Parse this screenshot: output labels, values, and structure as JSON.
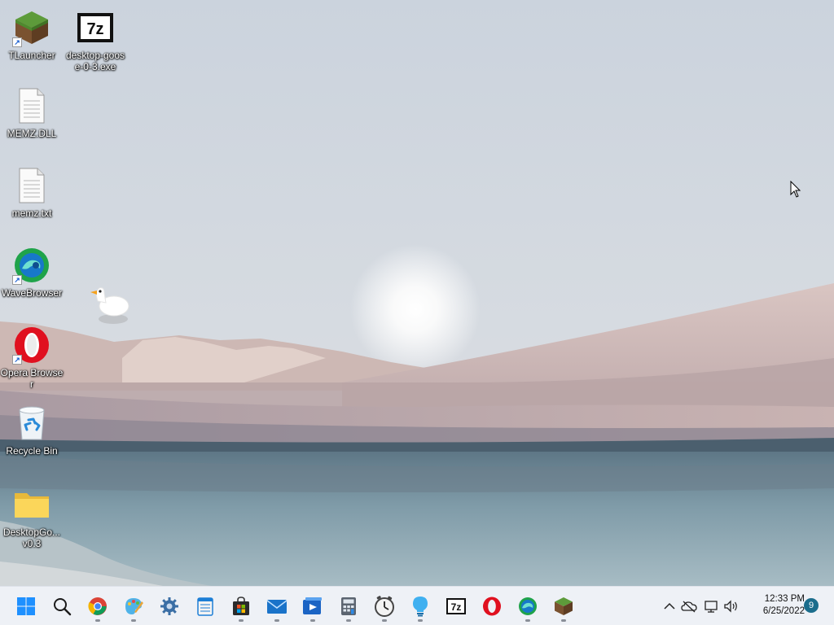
{
  "desktop": {
    "icons": [
      {
        "label": "TLauncher",
        "icon": "minecraft-grass-icon"
      },
      {
        "label": "desktop-goose-0-3.exe",
        "icon": "7zip-icon"
      },
      {
        "label": "MEMZ.DLL",
        "icon": "file-icon"
      },
      {
        "label": "memz.txt",
        "icon": "text-file-icon"
      },
      {
        "label": "WaveBrowser",
        "icon": "wavebrowser-icon"
      },
      {
        "label": "Opera Browser",
        "icon": "opera-icon"
      },
      {
        "label": "Recycle Bin",
        "icon": "recycle-bin-icon"
      },
      {
        "label": "DesktopGo... v0.3",
        "icon": "folder-icon"
      }
    ]
  },
  "taskbar": {
    "apps": [
      {
        "name": "Start",
        "icon": "windows-start-icon"
      },
      {
        "name": "Search",
        "icon": "search-icon"
      },
      {
        "name": "Google Chrome",
        "icon": "chrome-icon"
      },
      {
        "name": "Paint",
        "icon": "paint-icon"
      },
      {
        "name": "Settings",
        "icon": "gear-icon"
      },
      {
        "name": "Notepad",
        "icon": "notepad-icon"
      },
      {
        "name": "Microsoft Store",
        "icon": "store-icon"
      },
      {
        "name": "Mail",
        "icon": "mail-icon"
      },
      {
        "name": "Media Player",
        "icon": "media-player-icon"
      },
      {
        "name": "Calculator",
        "icon": "calculator-icon"
      },
      {
        "name": "Clock",
        "icon": "clock-icon"
      },
      {
        "name": "Tips",
        "icon": "lightbulb-icon"
      },
      {
        "name": "7-Zip",
        "icon": "7zip-icon"
      },
      {
        "name": "Opera",
        "icon": "opera-icon"
      },
      {
        "name": "WaveBrowser",
        "icon": "wavebrowser-icon"
      },
      {
        "name": "TLauncher",
        "icon": "minecraft-grass-icon"
      }
    ],
    "tray": {
      "time": "12:33 PM",
      "date": "6/25/2022",
      "notifications": "9"
    }
  },
  "colors": {
    "taskbar_bg": "#eef1f6",
    "accent": "#0078d4",
    "notification_badge": "#1b6d8c"
  }
}
